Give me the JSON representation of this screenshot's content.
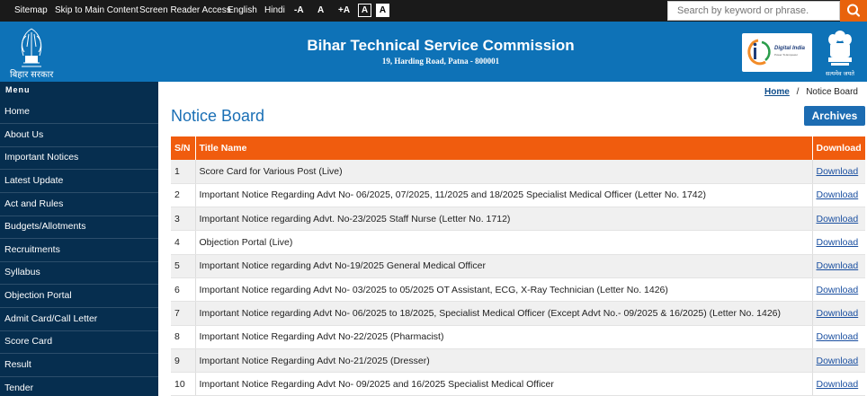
{
  "topbar": {
    "sitemap": "Sitemap",
    "skip": "Skip to Main Content",
    "screen_reader": "Screen Reader Access",
    "english": "English",
    "hindi": "Hindi",
    "font_dec": "-A",
    "font_normal": "A",
    "font_inc": "+A",
    "contrast_dark": "A",
    "contrast_light": "A",
    "search_placeholder": "Search by keyword or phrase."
  },
  "header": {
    "title": "Bihar Technical Service Commission",
    "address": "19, Harding Road, Patna - 800001",
    "state_logo_text": "बिहार सरकार",
    "digital_india_text": "Digital India",
    "digital_india_tagline": "Power To Empower",
    "emblem_text": "सत्यमेव जयते"
  },
  "sidebar": {
    "heading": "Menu",
    "items": [
      {
        "label": "Home"
      },
      {
        "label": "About Us"
      },
      {
        "label": "Important Notices"
      },
      {
        "label": "Latest Update"
      },
      {
        "label": "Act and Rules"
      },
      {
        "label": "Budgets/Allotments"
      },
      {
        "label": "Recruitments"
      },
      {
        "label": "Syllabus"
      },
      {
        "label": "Objection Portal"
      },
      {
        "label": "Admit Card/Call Letter"
      },
      {
        "label": "Score Card"
      },
      {
        "label": "Result"
      },
      {
        "label": "Tender"
      }
    ]
  },
  "breadcrumb": {
    "home": "Home",
    "separator": "/",
    "current": "Notice Board"
  },
  "main": {
    "title": "Notice Board",
    "archives_label": "Archives",
    "columns": [
      "S/N",
      "Title Name",
      "Download"
    ],
    "rows": [
      {
        "sn": "1",
        "title": "Score Card for Various Post (Live)",
        "download": "Download"
      },
      {
        "sn": "2",
        "title": "Important Notice Regarding Advt No- 06/2025, 07/2025, 11/2025 and 18/2025 Specialist Medical Officer (Letter No. 1742)",
        "download": "Download"
      },
      {
        "sn": "3",
        "title": "Important Notice regarding Advt. No-23/2025 Staff Nurse (Letter No. 1712)",
        "download": "Download"
      },
      {
        "sn": "4",
        "title": "Objection Portal (Live)",
        "download": "Download"
      },
      {
        "sn": "5",
        "title": "Important Notice regarding Advt No-19/2025 General Medical Officer",
        "download": "Download"
      },
      {
        "sn": "6",
        "title": "Important Notice regarding Advt No- 03/2025 to 05/2025 OT Assistant, ECG, X-Ray Technician (Letter No. 1426)",
        "download": "Download"
      },
      {
        "sn": "7",
        "title": "Important Notice regarding Advt No- 06/2025 to 18/2025, Specialist Medical Officer (Except Advt No.- 09/2025 & 16/2025) (Letter No. 1426)",
        "download": "Download"
      },
      {
        "sn": "8",
        "title": "Important Notice Regarding Advt No-22/2025 (Pharmacist)",
        "download": "Download"
      },
      {
        "sn": "9",
        "title": "Important Notice Regarding Advt No-21/2025 (Dresser)",
        "download": "Download"
      },
      {
        "sn": "10",
        "title": "Important Notice Regarding Advt No- 09/2025 and 16/2025 Specialist Medical Officer",
        "download": "Download"
      }
    ]
  },
  "colors": {
    "topbar_bg": "#1a1a1a",
    "header_bg": "#0e72b7",
    "sidebar_bg": "#062e4f",
    "table_header_bg": "#f05c0e",
    "search_button_bg": "#e8620c",
    "title_color": "#1a6fb5",
    "archives_bg": "#1c6cb2"
  },
  "icons": {
    "search": "search-icon",
    "state_emblem": "bihar-emblem-icon",
    "national_emblem": "national-emblem-icon",
    "digital_india": "digital-india-logo"
  }
}
